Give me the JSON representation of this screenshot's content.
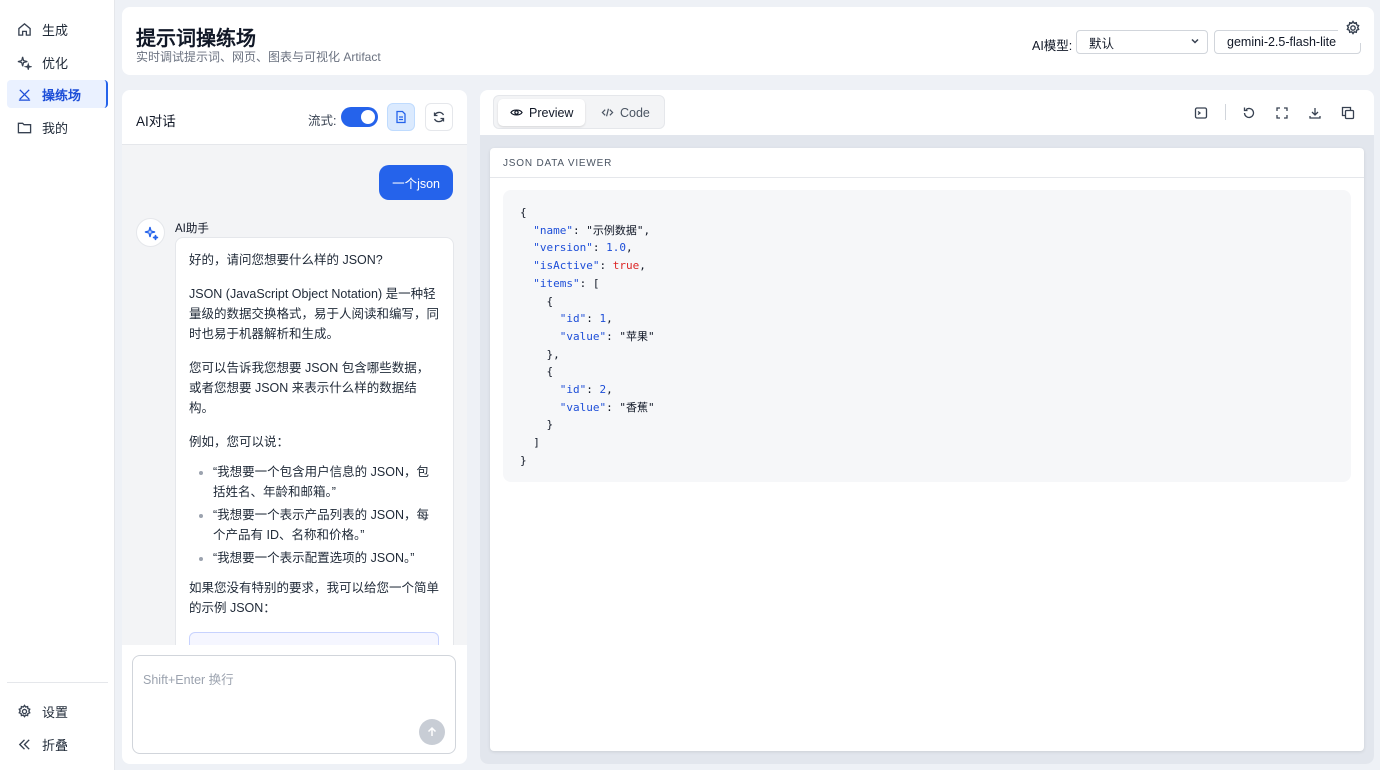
{
  "sidebar": {
    "items": [
      {
        "label": "生成",
        "icon": "home-icon"
      },
      {
        "label": "优化",
        "icon": "sparkle-icon"
      },
      {
        "label": "操练场",
        "icon": "playground-icon"
      },
      {
        "label": "我的",
        "icon": "folder-icon"
      }
    ],
    "footer": [
      {
        "label": "设置",
        "icon": "gear-icon"
      },
      {
        "label": "折叠",
        "icon": "collapse-icon"
      }
    ],
    "active_index": 2
  },
  "header": {
    "title": "提示词操练场",
    "subtitle": "实时调试提示词、网页、图表与可视化 Artifact",
    "model_label": "AI模型:",
    "provider_value": "默认",
    "model_value": "gemini-2.5-flash-lite"
  },
  "chat": {
    "title": "AI对话",
    "stream_label": "流式:",
    "stream_enabled": true,
    "user_message": "一个json",
    "assistant_name": "AI助手",
    "reply": {
      "p1": "好的，请问您想要什么样的 JSON?",
      "p2": "JSON (JavaScript Object Notation) 是一种轻量级的数据交换格式，易于人阅读和编写，同时也易于机器解析和生成。",
      "p3": "您可以告诉我您想要 JSON 包含哪些数据，或者您想要 JSON 来表示什么样的数据结构。",
      "p4": "例如，您可以说：",
      "bullets": [
        "“我想要一个包含用户信息的 JSON，包括姓名、年龄和邮箱。”",
        "“我想要一个表示产品列表的 JSON，每个产品有 ID、名称和价格。”",
        "“我想要一个表示配置选项的 JSON。”"
      ],
      "p5": "如果您没有特别的要求，我可以给您一个简单的示例 JSON：",
      "code_start": "{"
    },
    "input_placeholder": "Shift+Enter 换行"
  },
  "preview": {
    "tabs": [
      {
        "label": "Preview",
        "icon": "eye-icon"
      },
      {
        "label": "Code",
        "icon": "code-icon"
      }
    ],
    "active_tab": 0,
    "viewer_title": "JSON DATA VIEWER",
    "json": {
      "open": "{",
      "name_key": "\"name\"",
      "name_val": "\"示例数据\"",
      "version_key": "\"version\"",
      "version_val": "1.0",
      "active_key": "\"isActive\"",
      "active_val": "true",
      "items_key": "\"items\"",
      "item1_id_key": "\"id\"",
      "item1_id_val": "1",
      "item1_value_key": "\"value\"",
      "item1_value_val": "\"苹果\"",
      "item2_id_key": "\"id\"",
      "item2_id_val": "2",
      "item2_value_key": "\"value\"",
      "item2_value_val": "\"香蕉\"",
      "close": "}"
    }
  },
  "colors": {
    "accent": "#2563eb",
    "json_key": "#1d4ed8",
    "json_bool": "#dc2626"
  }
}
